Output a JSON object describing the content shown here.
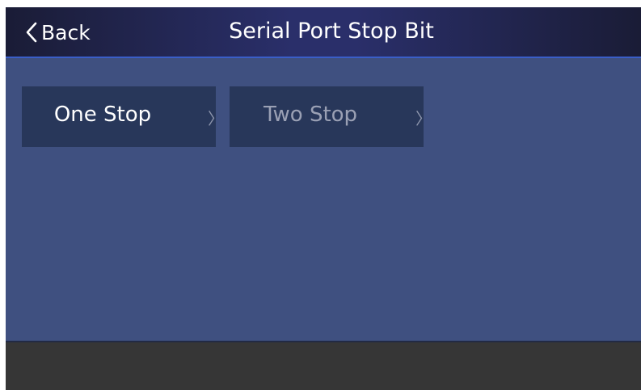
{
  "header": {
    "back_label": "Back",
    "title": "Serial Port Stop Bit"
  },
  "options": [
    {
      "label": "One Stop",
      "chevron": "〉",
      "state": "selected"
    },
    {
      "label": "Two Stop",
      "chevron": "〉",
      "state": "unselected"
    }
  ],
  "colors": {
    "background": "#3f5080",
    "header": "#1a1c36",
    "header_accent": "#3a5ec8",
    "option_bg": "#28375a",
    "selected_text": "#ffffff",
    "unselected_text": "#9aa0b4",
    "footer": "#363636"
  },
  "icons": {
    "back": "chevron-left-icon",
    "option_arrow": "chevron-right-icon"
  }
}
